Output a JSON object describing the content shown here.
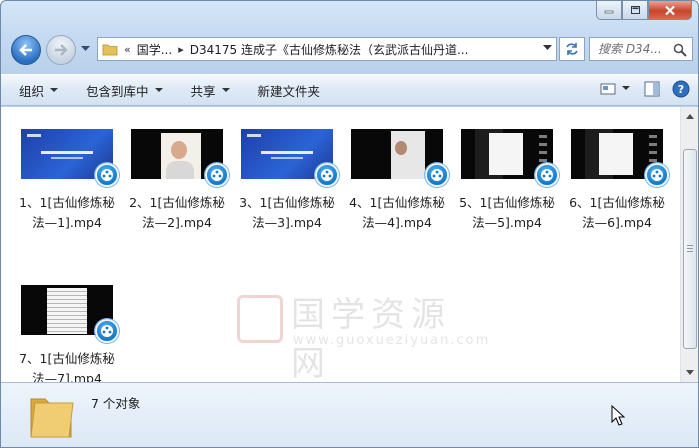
{
  "window": {
    "minimize_icon": "minimize-icon",
    "maximize_icon": "maximize-icon",
    "close_icon": "close-icon"
  },
  "nav": {
    "breadcrumb": [
      "«",
      "国学...",
      "D34175 连成子《古仙修炼秘法（玄武派古仙丹道..."
    ],
    "search_placeholder": "搜索 D34..."
  },
  "toolbar": {
    "organize": "组织",
    "include_in_library": "包含到库中",
    "share": "共享",
    "new_folder": "新建文件夹"
  },
  "files": [
    {
      "name": "1、1[古仙修炼秘法—1].mp4",
      "thumb": "blue"
    },
    {
      "name": "2、1[古仙修炼秘法—2].mp4",
      "thumb": "person"
    },
    {
      "name": "3、1[古仙修炼秘法—3].mp4",
      "thumb": "blue"
    },
    {
      "name": "4、1[古仙修炼秘法—4].mp4",
      "thumb": "board"
    },
    {
      "name": "5、1[古仙修炼秘法—5].mp4",
      "thumb": "dark"
    },
    {
      "name": "6、1[古仙修炼秘法—6].mp4",
      "thumb": "dark"
    },
    {
      "name": "7、1[古仙修炼秘法—7].mp4",
      "thumb": "doc"
    }
  ],
  "watermark": {
    "text": "国学资源网",
    "url": "www.guoxueziyuan.com"
  },
  "status": {
    "count": "7 个对象"
  },
  "colors": {
    "accent": "#2a6fc3",
    "frame": "#c3d9f1"
  }
}
